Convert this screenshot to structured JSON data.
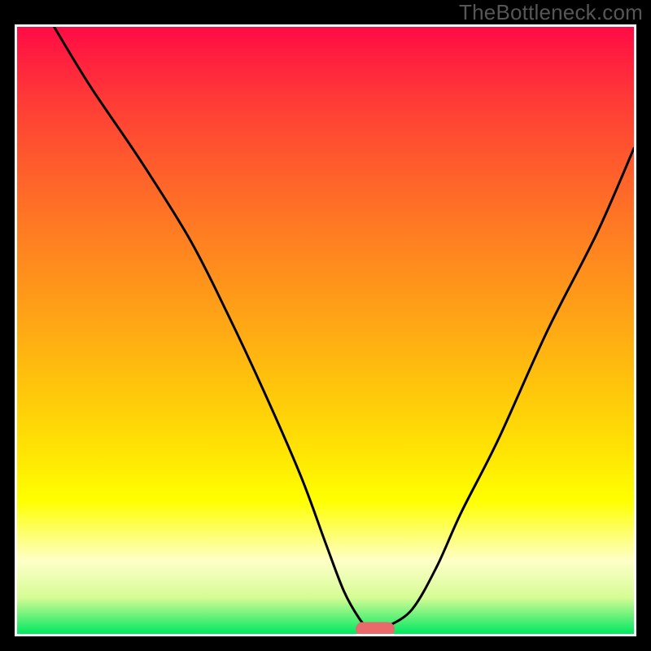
{
  "watermark": "TheBottleneck.com",
  "chart_data": {
    "type": "line",
    "title": "",
    "xlabel": "",
    "ylabel": "",
    "x_range": [
      0,
      100
    ],
    "y_range": [
      0,
      100
    ],
    "series": [
      {
        "name": "curve",
        "x": [
          6,
          12,
          20,
          28,
          34,
          40,
          46,
          50,
          53,
          55.5,
          57,
          58.5,
          60,
          64,
          68,
          72,
          78,
          86,
          94,
          100
        ],
        "y": [
          100,
          90,
          78,
          65,
          53,
          40,
          26,
          15,
          7,
          2.5,
          1,
          0.7,
          1.2,
          4,
          11,
          20,
          32,
          50,
          66,
          80
        ]
      }
    ],
    "annotations": [
      {
        "type": "pill-marker",
        "x": 58,
        "y": 0.8,
        "color": "#e86a6a"
      }
    ],
    "background": {
      "type": "vertical-gradient",
      "stops": [
        {
          "pos": 0,
          "color": "#ff0c45"
        },
        {
          "pos": 0.5,
          "color": "#ffae12"
        },
        {
          "pos": 0.8,
          "color": "#ffff00"
        },
        {
          "pos": 1.0,
          "color": "#00e861"
        }
      ]
    }
  },
  "plot": {
    "inner_w": 758,
    "inner_h": 746
  }
}
